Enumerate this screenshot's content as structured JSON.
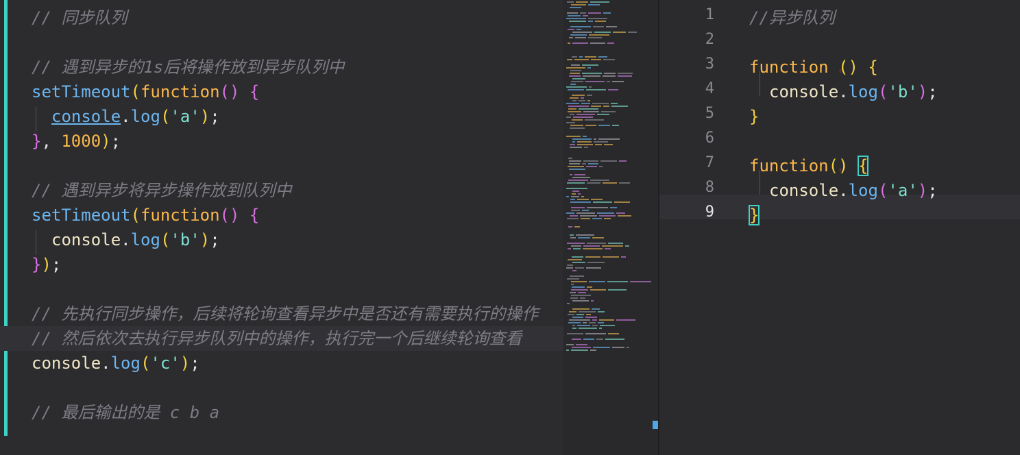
{
  "left_editor": {
    "lines": [
      {
        "row": 0,
        "indent": 0,
        "tokens": [
          {
            "t": "// 同步队列",
            "c": "cmt"
          }
        ]
      },
      {
        "row": 2,
        "indent": 0,
        "tokens": [
          {
            "t": "// 遇到异步的1s后将操作放到异步队列中",
            "c": "cmt"
          }
        ]
      },
      {
        "row": 3,
        "indent": 0,
        "tokens": [
          {
            "t": "setTimeout",
            "c": "fn"
          },
          {
            "t": "(",
            "c": "br2"
          },
          {
            "t": "function",
            "c": "kw"
          },
          {
            "t": "()",
            "c": "br1"
          },
          {
            "t": " ",
            "c": "punc"
          },
          {
            "t": "{",
            "c": "br1"
          }
        ]
      },
      {
        "row": 4,
        "indent": 1,
        "tokens": [
          {
            "t": "console",
            "c": "obj-ul"
          },
          {
            "t": ".",
            "c": "punc"
          },
          {
            "t": "log",
            "c": "fn"
          },
          {
            "t": "(",
            "c": "br2"
          },
          {
            "t": "'a'",
            "c": "str"
          },
          {
            "t": ")",
            "c": "br2"
          },
          {
            "t": ";",
            "c": "punc"
          }
        ]
      },
      {
        "row": 5,
        "indent": 0,
        "tokens": [
          {
            "t": "}",
            "c": "br1"
          },
          {
            "t": ", ",
            "c": "punc"
          },
          {
            "t": "1000",
            "c": "num"
          },
          {
            "t": ")",
            "c": "br2"
          },
          {
            "t": ";",
            "c": "punc"
          }
        ]
      },
      {
        "row": 7,
        "indent": 0,
        "tokens": [
          {
            "t": "// 遇到异步将异步操作放到队列中",
            "c": "cmt"
          }
        ]
      },
      {
        "row": 8,
        "indent": 0,
        "tokens": [
          {
            "t": "setTimeout",
            "c": "fn"
          },
          {
            "t": "(",
            "c": "br2"
          },
          {
            "t": "function",
            "c": "kw"
          },
          {
            "t": "()",
            "c": "br1"
          },
          {
            "t": " ",
            "c": "punc"
          },
          {
            "t": "{",
            "c": "br1"
          }
        ]
      },
      {
        "row": 9,
        "indent": 1,
        "tokens": [
          {
            "t": "console",
            "c": "obj"
          },
          {
            "t": ".",
            "c": "punc"
          },
          {
            "t": "log",
            "c": "fn"
          },
          {
            "t": "(",
            "c": "br2"
          },
          {
            "t": "'b'",
            "c": "str"
          },
          {
            "t": ")",
            "c": "br2"
          },
          {
            "t": ";",
            "c": "punc"
          }
        ]
      },
      {
        "row": 10,
        "indent": 0,
        "tokens": [
          {
            "t": "}",
            "c": "br1"
          },
          {
            "t": ")",
            "c": "br2"
          },
          {
            "t": ";",
            "c": "punc"
          }
        ]
      },
      {
        "row": 12,
        "indent": 0,
        "tokens": [
          {
            "t": "// 先执行同步操作，后续将轮询查看异步中是否还有需要执行的操作",
            "c": "cmt"
          }
        ]
      },
      {
        "row": 13,
        "indent": 0,
        "tokens": [
          {
            "t": "// 然后依次去执行异步队列中的操作，执行完一个后继续轮询查看",
            "c": "cmt"
          }
        ]
      },
      {
        "row": 14,
        "indent": 0,
        "tokens": [
          {
            "t": "console",
            "c": "obj"
          },
          {
            "t": ".",
            "c": "punc"
          },
          {
            "t": "log",
            "c": "fn"
          },
          {
            "t": "(",
            "c": "br2"
          },
          {
            "t": "'c'",
            "c": "str"
          },
          {
            "t": ")",
            "c": "br2"
          },
          {
            "t": ";",
            "c": "punc"
          }
        ]
      },
      {
        "row": 16,
        "indent": 0,
        "tokens": [
          {
            "t": "// 最后输出的是 c b a",
            "c": "cmt"
          }
        ]
      }
    ]
  },
  "right_editor": {
    "line_numbers": [
      "1",
      "2",
      "3",
      "4",
      "5",
      "6",
      "7",
      "8",
      "9"
    ],
    "active_line": "9",
    "lines": [
      {
        "row": 0,
        "indent": 0,
        "tokens": [
          {
            "t": "//异步队列",
            "c": "cmt"
          }
        ]
      },
      {
        "row": 2,
        "indent": 0,
        "tokens": [
          {
            "t": "function",
            "c": "kw"
          },
          {
            "t": " ",
            "c": "punc"
          },
          {
            "t": "()",
            "c": "br2"
          },
          {
            "t": " ",
            "c": "punc"
          },
          {
            "t": "{",
            "c": "br2"
          }
        ]
      },
      {
        "row": 3,
        "indent": 1,
        "tokens": [
          {
            "t": "console",
            "c": "obj"
          },
          {
            "t": ".",
            "c": "punc"
          },
          {
            "t": "log",
            "c": "fn"
          },
          {
            "t": "(",
            "c": "br1"
          },
          {
            "t": "'b'",
            "c": "str"
          },
          {
            "t": ")",
            "c": "br1"
          },
          {
            "t": ";",
            "c": "punc"
          }
        ]
      },
      {
        "row": 4,
        "indent": 0,
        "tokens": [
          {
            "t": "}",
            "c": "br2"
          }
        ]
      },
      {
        "row": 6,
        "indent": 0,
        "tokens": [
          {
            "t": "function",
            "c": "kw"
          },
          {
            "t": "()",
            "c": "br2"
          },
          {
            "t": " ",
            "c": "punc"
          },
          {
            "t": "{",
            "c": "br2 box"
          }
        ]
      },
      {
        "row": 7,
        "indent": 1,
        "tokens": [
          {
            "t": "console",
            "c": "obj"
          },
          {
            "t": ".",
            "c": "punc"
          },
          {
            "t": "log",
            "c": "fn"
          },
          {
            "t": "(",
            "c": "br1"
          },
          {
            "t": "'a'",
            "c": "str"
          },
          {
            "t": ")",
            "c": "br1"
          },
          {
            "t": ";",
            "c": "punc"
          }
        ]
      },
      {
        "row": 8,
        "indent": 0,
        "tokens": [
          {
            "t": "}",
            "c": "br2 box"
          }
        ]
      }
    ]
  }
}
